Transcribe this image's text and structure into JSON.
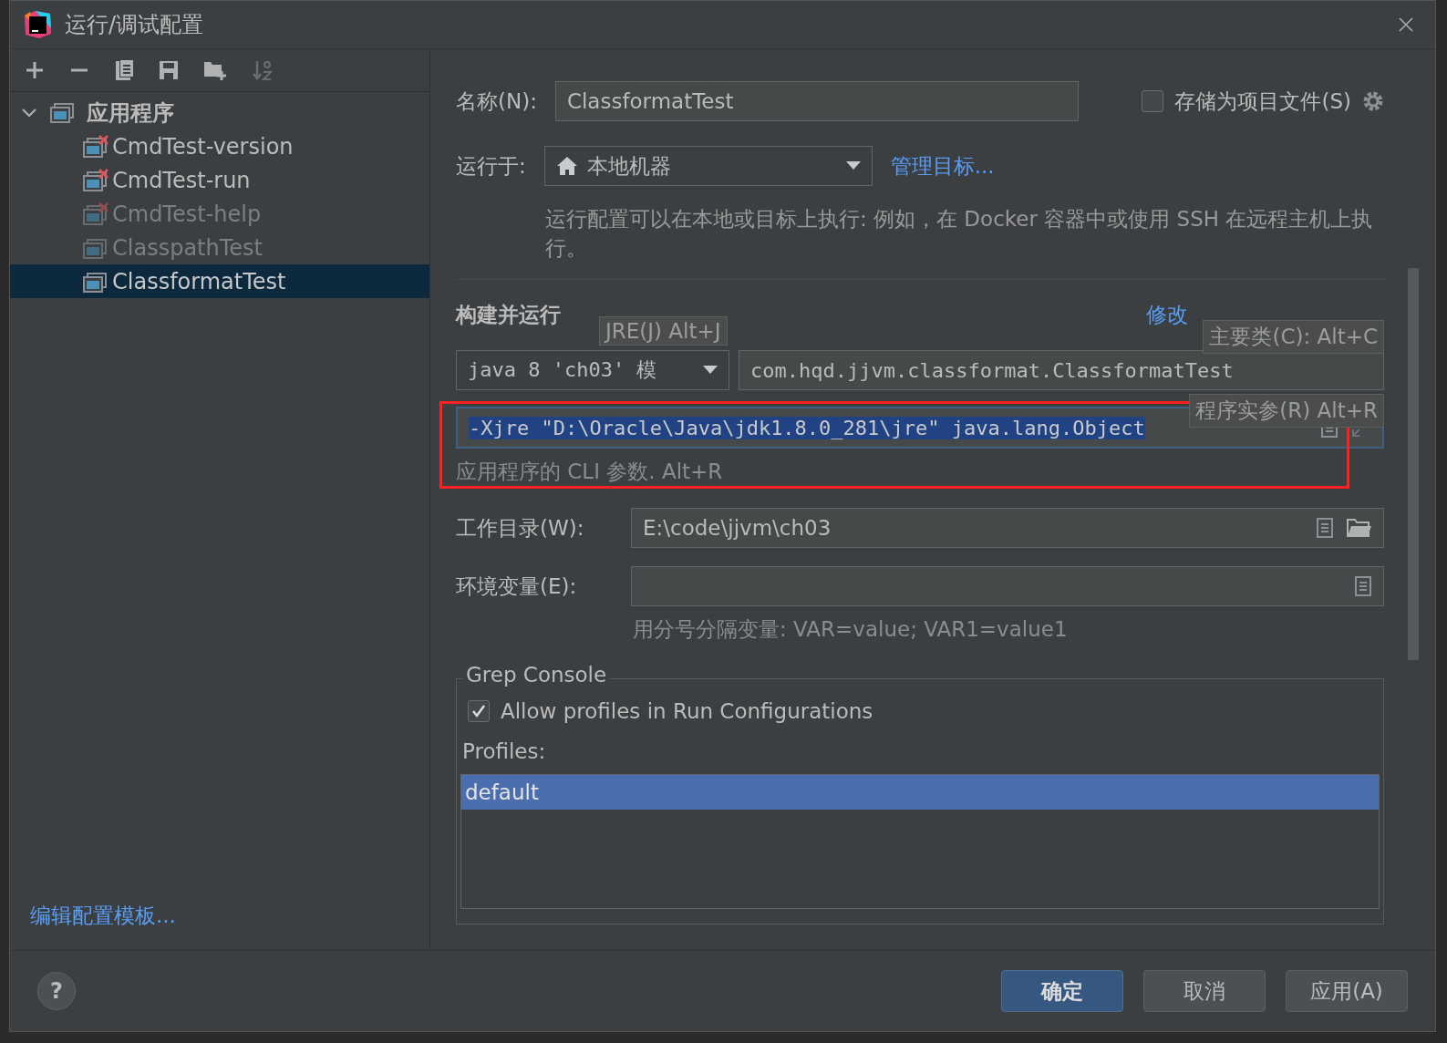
{
  "window": {
    "title": "运行/调试配置"
  },
  "toolbar": [
    {
      "kind": "add",
      "disabled": false
    },
    {
      "kind": "remove",
      "disabled": false
    },
    {
      "kind": "copy",
      "disabled": false
    },
    {
      "kind": "save",
      "disabled": false
    },
    {
      "kind": "folder",
      "disabled": false
    },
    {
      "kind": "sort",
      "disabled": true
    }
  ],
  "tree": {
    "label": "应用程序",
    "expanded": true,
    "children": [
      {
        "label": "CmdTest-version",
        "error": true,
        "disabled": false,
        "selected": false
      },
      {
        "label": "CmdTest-run",
        "error": true,
        "disabled": false,
        "selected": false
      },
      {
        "label": "CmdTest-help",
        "error": true,
        "disabled": true,
        "selected": false
      },
      {
        "label": "ClasspathTest",
        "error": false,
        "disabled": true,
        "selected": false
      },
      {
        "label": "ClassformatTest",
        "error": false,
        "disabled": false,
        "selected": true
      }
    ]
  },
  "edit_templates_link": "编辑配置模板...",
  "name": {
    "label": "名称(N):",
    "value": "ClassformatTest"
  },
  "store_as_project_file": {
    "label": "存储为项目文件(S)",
    "checked": false
  },
  "run_on": {
    "label": "运行于:",
    "value": "本地机器",
    "link": "管理目标...",
    "hint": "运行配置可以在本地或目标上执行: 例如，在 Docker 容器中或使用 SSH 在远程主机上执行。"
  },
  "section": {
    "title": "构建并运行",
    "modify_options": "修改"
  },
  "jre": {
    "value": "java 8 'ch03' 模",
    "tooltip": "JRE(J) Alt+J"
  },
  "main_class": {
    "value": "com.hqd.jjvm.classformat.ClassformatTest",
    "tooltip": "主要类(C): Alt+C"
  },
  "program_args": {
    "value": "-Xjre \"D:\\Oracle\\Java\\jdk1.8.0_281\\jre\" java.lang.Object",
    "selected": true,
    "highlighted": true,
    "tooltip": "程序实参(R) Alt+R",
    "hint": "应用程序的 CLI 参数. Alt+R"
  },
  "working_dir": {
    "label": "工作目录(W):",
    "value": "E:\\code\\jjvm\\ch03"
  },
  "env": {
    "label": "环境变量(E):",
    "hint": "用分号分隔变量: VAR=value; VAR1=value1"
  },
  "grep_console": {
    "title": "Grep Console",
    "allow_profiles": {
      "label": "Allow profiles in Run Configurations",
      "checked": true
    },
    "profiles_label": "Profiles:",
    "profiles": [
      {
        "label": "default",
        "selected": true
      }
    ]
  },
  "help": "?",
  "buttons": [
    {
      "label": "确定",
      "kind": "primary"
    },
    {
      "label": "取消",
      "kind": "normal"
    },
    {
      "label": "应用(A)",
      "kind": "normal"
    }
  ]
}
